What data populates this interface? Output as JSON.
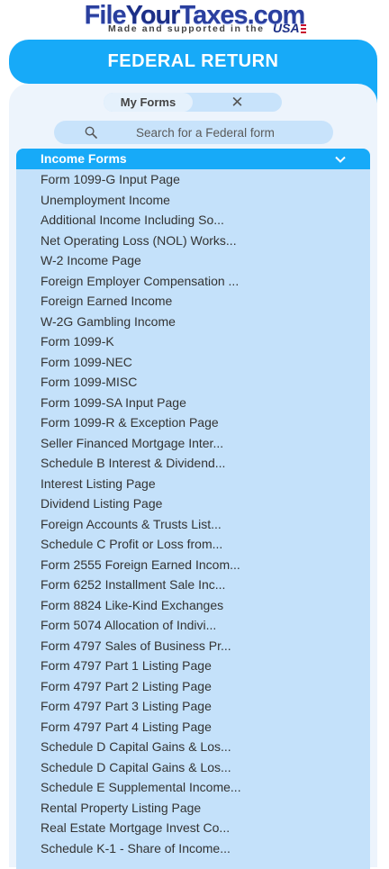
{
  "logo": {
    "name_part1": "File",
    "name_part2": "Your",
    "name_part3": "Taxes.com",
    "tagline": "Made and supported in the",
    "country": "USA"
  },
  "header": {
    "title": "FEDERAL RETURN"
  },
  "toggle": {
    "my_forms_label": "My Forms",
    "close_glyph": "✕"
  },
  "search": {
    "placeholder": "Search for a Federal form",
    "value": ""
  },
  "section": {
    "title": "Income Forms",
    "items": [
      "Form 1099-G Input Page",
      "Unemployment Income",
      "Additional Income Including So...",
      "Net Operating Loss (NOL) Works...",
      "W-2 Income Page",
      "Foreign Employer Compensation ...",
      "Foreign Earned Income",
      "W-2G Gambling Income",
      "Form 1099-K",
      "Form 1099-NEC",
      "Form 1099-MISC",
      "Form 1099-SA Input Page",
      "Form 1099-R & Exception Page",
      "Seller Financed Mortgage Inter...",
      "Schedule B Interest & Dividend...",
      "Interest Listing Page",
      "Dividend Listing Page",
      "Foreign Accounts & Trusts List...",
      "Schedule C Profit or Loss from...",
      "Form 2555 Foreign Earned Incom...",
      "Form 6252 Installment Sale Inc...",
      "Form 8824 Like-Kind Exchanges",
      "Form 5074 Allocation of Indivi...",
      "Form 4797 Sales of Business Pr...",
      "Form 4797 Part 1 Listing Page",
      "Form 4797 Part 2 Listing Page",
      "Form 4797 Part 3 Listing Page",
      "Form 4797 Part 4 Listing Page",
      "Schedule D Capital Gains & Los...",
      "Schedule D Capital Gains & Los...",
      "Schedule E Supplemental Income...",
      "Rental Property Listing Page",
      "Real Estate Mortgage Invest Co...",
      "Schedule K-1 - Share of Income..."
    ]
  },
  "colors": {
    "accent": "#17aaf8",
    "panel": "#edf4fc",
    "section_bg": "#c4e1fa"
  }
}
